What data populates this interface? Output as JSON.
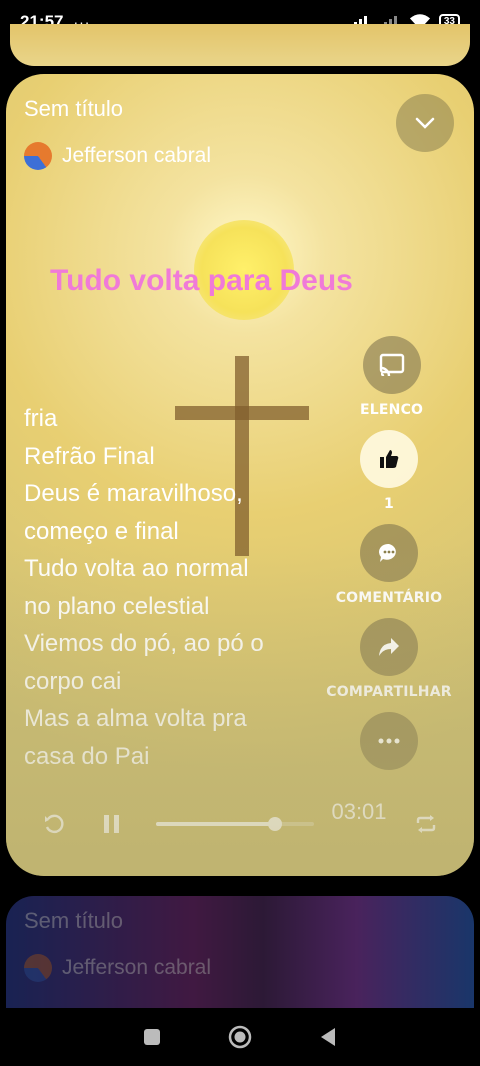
{
  "status_bar": {
    "time": "21:57",
    "more": "···",
    "battery": "33"
  },
  "player": {
    "title": "Sem título",
    "author": "Jefferson cabral",
    "song_heading": "Tudo volta para Deus",
    "lyrics": [
      "fria",
      "Refrão Final",
      "Deus é maravilhoso,",
      "começo e final",
      "Tudo volta ao normal",
      "no plano celestial",
      "Viemos do pó, ao pó o",
      "corpo cai",
      "Mas a alma volta pra",
      "casa do Pai"
    ],
    "actions": {
      "cast_label": "ELENCO",
      "like_count": "1",
      "comment_label": "COMENTÁRIO",
      "share_label": "COMPARTILHAR"
    },
    "time_display": "03:01",
    "progress": 0.75
  },
  "next_card": {
    "title": "Sem título",
    "author": "Jefferson cabral"
  },
  "colors": {
    "heading_pink": "#f07ad8",
    "card_yellow": "#e8cf72"
  }
}
